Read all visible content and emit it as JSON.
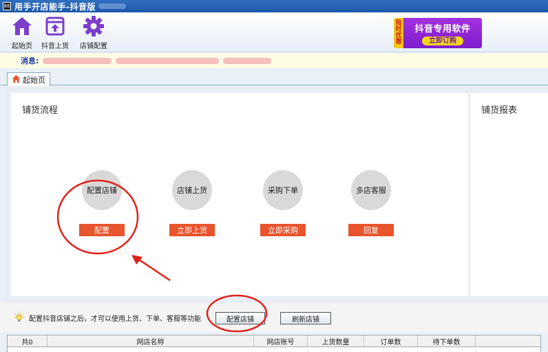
{
  "window": {
    "title": "用手开店能手-抖音版",
    "icon_text": "88"
  },
  "toolbar": {
    "items": [
      {
        "label": "起始页",
        "icon": "home-icon"
      },
      {
        "label": "抖音上货",
        "icon": "upload-icon"
      },
      {
        "label": "店铺配置",
        "icon": "gear-icon"
      }
    ]
  },
  "promo": {
    "side_text": [
      "限",
      "时",
      "优",
      "惠"
    ],
    "title": "抖音专用软件",
    "button": "立即订购"
  },
  "message": {
    "label": "消息:"
  },
  "tabs": [
    {
      "label": "起始页",
      "icon": "home-icon"
    }
  ],
  "flow_panel": {
    "title": "铺货流程",
    "steps": [
      {
        "name": "配置店铺",
        "action": "配置"
      },
      {
        "name": "店铺上货",
        "action": "立即上货"
      },
      {
        "name": "采购下单",
        "action": "立即采购"
      },
      {
        "name": "多店客服",
        "action": "回复"
      }
    ]
  },
  "report_panel": {
    "title": "铺货报表"
  },
  "hint": {
    "text": "配置抖音店铺之后，才可以使用上货、下单、客服等功能",
    "config_button": "配置店铺",
    "refresh_button": "刷新店铺"
  },
  "shop_table": {
    "columns": [
      "共0",
      "网店名称",
      "网店账号",
      "上货数量",
      "订单数",
      "待下单数"
    ]
  },
  "colors": {
    "accent_orange": "#e8542c",
    "title_blue": "#1e58a8",
    "annotation_red": "#e0211b",
    "promo_purple": "#8a22d4"
  }
}
